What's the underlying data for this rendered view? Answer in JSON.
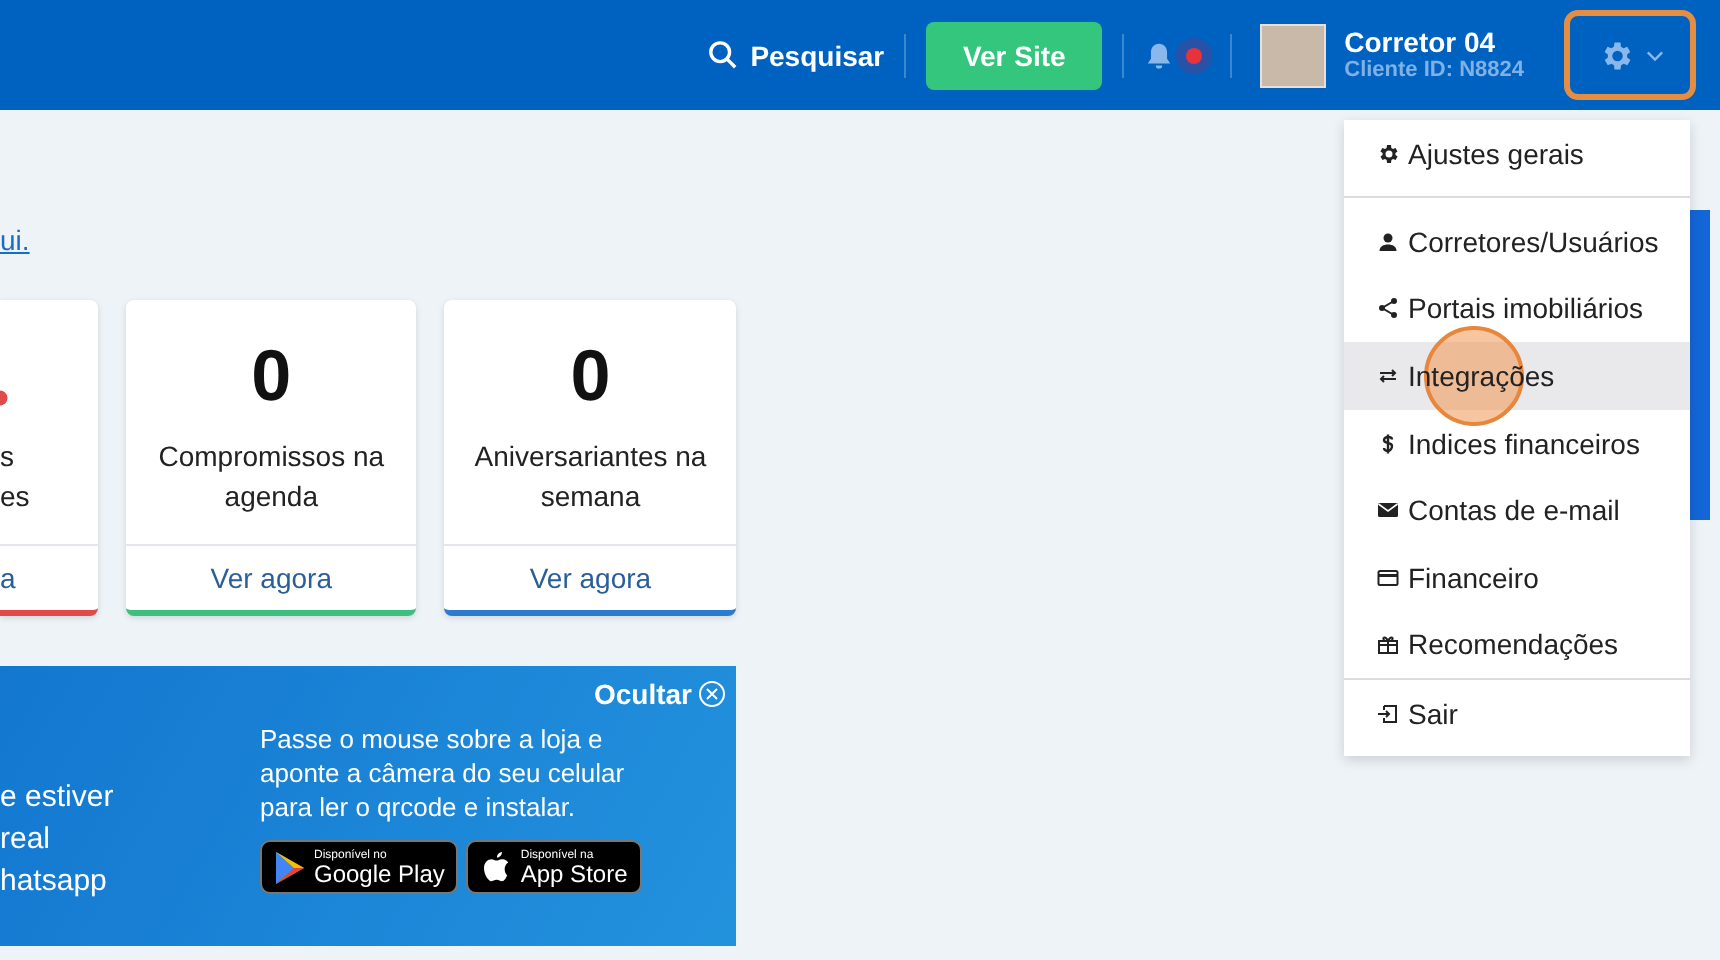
{
  "header": {
    "search_label": "Pesquisar",
    "site_button": "Ver Site",
    "notifications_unread": true,
    "user": {
      "name": "Corretor 04",
      "client_id": "Cliente ID: N8824"
    },
    "settings_focused": true
  },
  "notice_link": "ui.",
  "cards": [
    {
      "kind": "partial",
      "lines": [
        "s",
        "es"
      ],
      "link": "a",
      "color": "#e04a4a",
      "alert": true
    },
    {
      "kind": "full",
      "number": "0",
      "lines": [
        "Compromissos na",
        "agenda"
      ],
      "link": "Ver agora",
      "color": "#3dbf7f",
      "alert": false
    },
    {
      "kind": "full",
      "number": "0",
      "lines": [
        "Aniversariantes na",
        "semana"
      ],
      "link": "Ver agora",
      "color": "#2b7bd0",
      "alert": false
    }
  ],
  "app_banner": {
    "left_lines": [
      "e estiver",
      "real",
      "hatsapp"
    ],
    "hide_label": "Ocultar",
    "text": "Passe o mouse sobre a loja e aponte a câmera do seu celular para ler o qrcode e instalar.",
    "stores": [
      {
        "kind": "google",
        "small": "Disponível no",
        "big": "Google Play"
      },
      {
        "kind": "apple",
        "small": "Disponível na",
        "big": "App Store"
      }
    ]
  },
  "settings_menu": [
    {
      "label": "Ajustes gerais",
      "divider_after": true,
      "highlighted": false
    },
    {
      "label": "Corretores/Usuários",
      "divider_after": false,
      "highlighted": false
    },
    {
      "label": "Portais imobiliários",
      "divider_after": false,
      "highlighted": false
    },
    {
      "label": "Integrações",
      "divider_after": false,
      "highlighted": true
    },
    {
      "label": "Indices financeiros",
      "divider_after": false,
      "highlighted": false
    },
    {
      "label": "Contas de e-mail",
      "divider_after": false,
      "highlighted": false
    },
    {
      "label": "Financeiro",
      "divider_after": false,
      "highlighted": false
    },
    {
      "label": "Recomendações",
      "divider_after": true,
      "highlighted": false
    },
    {
      "label": "Sair",
      "divider_after": false,
      "highlighted": false
    }
  ],
  "click_marker": true
}
